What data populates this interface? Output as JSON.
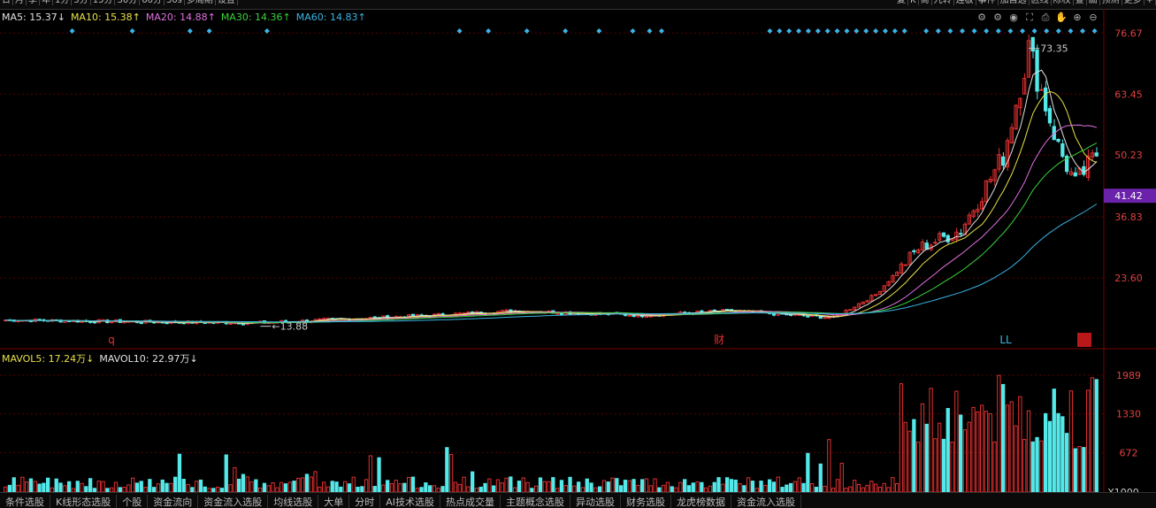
{
  "topbar": {
    "left_buttons": [
      "日",
      "月",
      "季",
      "年",
      "1分",
      "5分",
      "15分",
      "30分",
      "60分",
      "30s",
      "多周期",
      "设置"
    ],
    "right_buttons": [
      "复",
      "K",
      "筒",
      "九转",
      "连板",
      "事件",
      "加自选",
      "区线",
      "除权",
      "叠",
      "画",
      "预测",
      "更多",
      "+"
    ]
  },
  "price_legend": [
    {
      "name": "MA5",
      "value": "15.37",
      "arrow": "↓",
      "color": "#e0e0e0"
    },
    {
      "name": "MA10",
      "value": "15.38",
      "arrow": "↑",
      "color": "#e8e04a"
    },
    {
      "name": "MA20",
      "value": "14.88",
      "arrow": "↑",
      "color": "#e070e0"
    },
    {
      "name": "MA30",
      "value": "14.36",
      "arrow": "↑",
      "color": "#3ad23a"
    },
    {
      "name": "MA60",
      "value": "14.83",
      "arrow": "↑",
      "color": "#3ab4e6"
    }
  ],
  "volume_legend": [
    {
      "name": "MAVOL5",
      "value": "17.24万",
      "arrow": "↓",
      "color": "#e8e04a"
    },
    {
      "name": "MAVOL10",
      "value": "22.97万",
      "arrow": "↓",
      "color": "#e0e0e0"
    }
  ],
  "tools": [
    "⚙",
    "⚙",
    "◉",
    "⛶",
    "⎙",
    "✋",
    "⊕",
    "⊖"
  ],
  "price_axis": {
    "ticks": [
      "76.67",
      "63.45",
      "50.23",
      "36.83",
      "23.60"
    ],
    "current_price": "41.42",
    "high_marker": "73.35",
    "low_marker": "13.88"
  },
  "volume_axis": {
    "ticks": [
      "1989",
      "1330",
      "672"
    ],
    "unit": "X1000"
  },
  "event_marks": [
    {
      "label": "q",
      "color": "#e03030"
    },
    {
      "label": "财",
      "color": "#e03030"
    },
    {
      "label": "LL",
      "color": "#3ab4e6"
    },
    {
      "label": "榜",
      "color": "#ffffff"
    }
  ],
  "bottom_tabs": [
    "条件选股",
    "K线形态选股",
    "个股",
    "资金流向",
    "资金流入选股",
    "均线选股",
    "大单",
    "分时",
    "AI技术选股",
    "热点成交量",
    "主题概念选股",
    "异动选股",
    "财务选股",
    "龙虎榜数据",
    "资金流入选股"
  ],
  "colors": {
    "up": "#e03030",
    "down": "#54e8e8",
    "grid": "#5a0000",
    "axis_text": "#e04040",
    "current_price_bg": "#6a22aa"
  },
  "chart_data": {
    "type": "candlestick",
    "price_range": [
      10,
      80
    ],
    "volume_range_k": [
      0,
      2200
    ],
    "n_bars": 240,
    "key_points": [
      {
        "bar": 0,
        "price": 14.5
      },
      {
        "bar": 40,
        "price": 14.0
      },
      {
        "bar": 60,
        "price": 13.9
      },
      {
        "bar": 100,
        "price": 15.5
      },
      {
        "bar": 120,
        "price": 16.5
      },
      {
        "bar": 150,
        "price": 15.5
      },
      {
        "bar": 170,
        "price": 16.5
      },
      {
        "bar": 195,
        "price": 15.0
      },
      {
        "bar": 205,
        "price": 20.0
      },
      {
        "bar": 215,
        "price": 30.0
      },
      {
        "bar": 225,
        "price": 34.0
      },
      {
        "bar": 235,
        "price": 50.0
      },
      {
        "bar": 241,
        "price": 73.35
      },
      {
        "bar": 248,
        "price": 52.0
      },
      {
        "bar": 252,
        "price": 44.0
      },
      {
        "bar": 257,
        "price": 50.5
      }
    ]
  }
}
